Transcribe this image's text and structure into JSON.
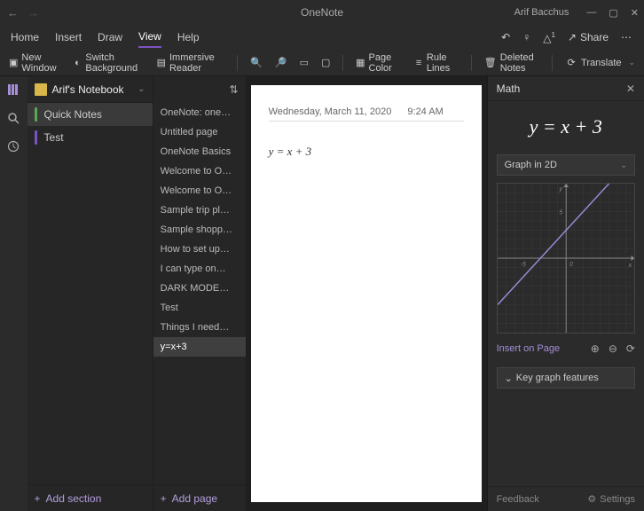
{
  "app": {
    "title": "OneNote",
    "user": "Arif Bacchus"
  },
  "menu": {
    "items": [
      "Home",
      "Insert",
      "Draw",
      "View",
      "Help"
    ],
    "active_index": 3,
    "share": "Share"
  },
  "toolbar": {
    "new_window": "New Window",
    "switch_bg": "Switch Background",
    "immersive": "Immersive Reader",
    "page_color": "Page Color",
    "rule_lines": "Rule Lines",
    "deleted_notes": "Deleted Notes",
    "translate": "Translate"
  },
  "notebook": {
    "name": "Arif's Notebook",
    "sections": [
      {
        "label": "Quick Notes",
        "color": "#5aa758",
        "active": true
      },
      {
        "label": "Test",
        "color": "#7b53c1",
        "active": false
      }
    ],
    "add_section": "Add section"
  },
  "pages": {
    "items": [
      "OneNote: one…",
      "Untitled page",
      "OneNote Basics",
      "Welcome to O…",
      "Welcome to O…",
      "Sample trip pl…",
      "Sample shopp…",
      "How to set up…",
      "I can type on…",
      "DARK MODE…",
      "Test",
      "Things I need…",
      "y=x+3"
    ],
    "active_index": 12,
    "add_page": "Add page"
  },
  "page": {
    "date": "Wednesday, March 11, 2020",
    "time": "9:24 AM",
    "equation": "y = x + 3"
  },
  "math": {
    "title": "Math",
    "equation": "y = x + 3",
    "graph_dropdown": "Graph in 2D",
    "insert": "Insert on Page",
    "key_features": "Key graph features",
    "feedback": "Feedback",
    "settings": "Settings"
  },
  "chart_data": {
    "type": "line",
    "title": "",
    "xlabel": "x",
    "ylabel": "y",
    "xlim": [
      -8,
      8
    ],
    "ylim": [
      -8,
      8
    ],
    "x_ticks": [
      -5,
      0
    ],
    "y_ticks": [
      0,
      5
    ],
    "series": [
      {
        "name": "y = x + 3",
        "x": [
          -8,
          -5,
          0,
          5,
          8
        ],
        "values": [
          -5,
          -2,
          3,
          8,
          11
        ]
      }
    ]
  }
}
